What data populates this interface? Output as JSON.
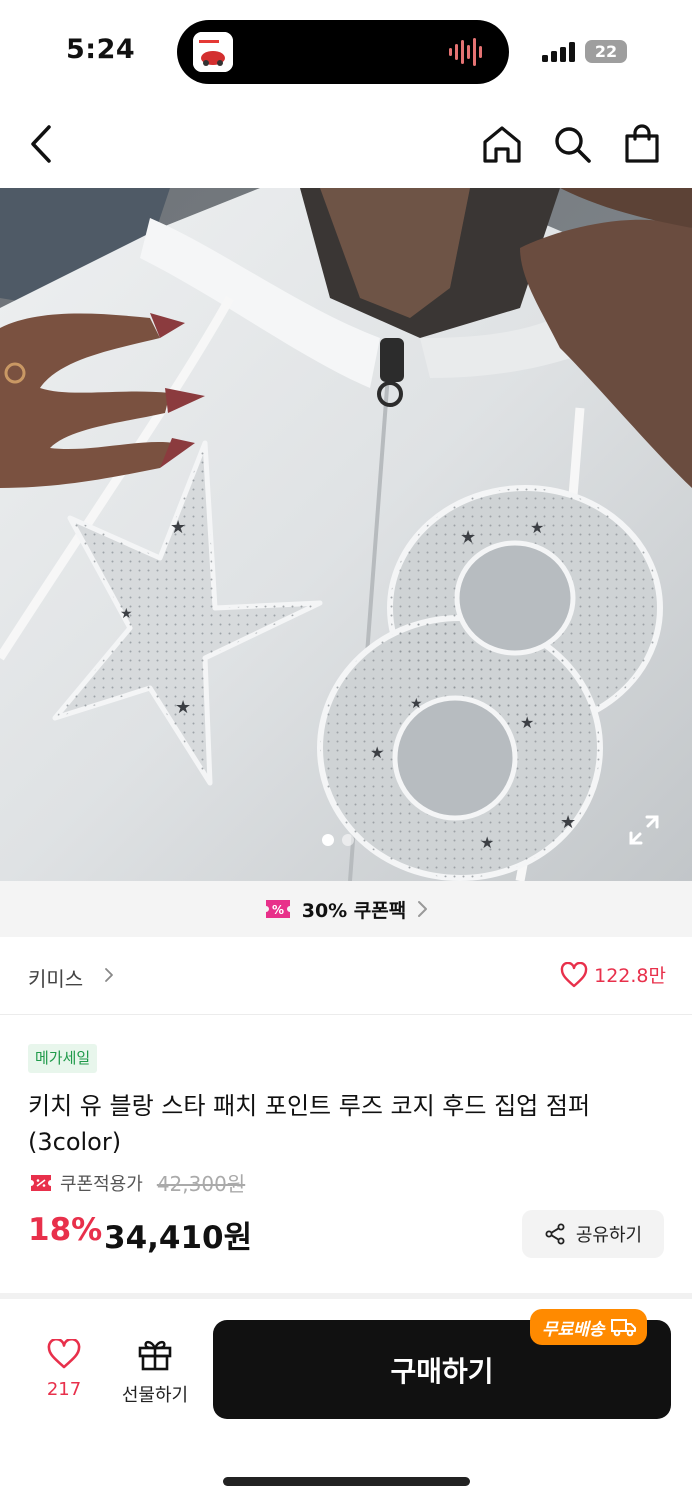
{
  "status_bar": {
    "time": "5:24",
    "battery": "22",
    "icons": [
      "app-icon",
      "audio-wave-icon",
      "signal-icon",
      "battery-icon"
    ]
  },
  "nav": {
    "icons": [
      "back-icon",
      "home-icon",
      "search-icon",
      "shopping-bag-icon"
    ]
  },
  "gallery": {
    "page_count": 2,
    "current_page": 1,
    "icons": [
      "expand-icon"
    ]
  },
  "coupon_strip": {
    "label": "30% 쿠폰팩",
    "icons": [
      "coupon-icon",
      "chevron-right-icon"
    ]
  },
  "brand": {
    "name": "키미스",
    "like_count": "122.8만",
    "icons": [
      "chevron-right-icon",
      "heart-outline-icon"
    ]
  },
  "product": {
    "badge": "메가세일",
    "title": "키치 유 블랑 스타 패치 포인트 루즈 코지 후드 집업 점퍼 (3color)",
    "coupon_price_label": "쿠폰적용가",
    "original_price": "42,300원",
    "discount_rate": "18%",
    "sale_price": "34,410원",
    "share_label": "공유하기"
  },
  "bottom_bar": {
    "wish_count": "217",
    "gift_label": "선물하기",
    "buy_label": "구매하기",
    "free_shipping": "무료배송"
  },
  "colors": {
    "accent": "#e8304b",
    "badge_green": "#1f9a4a",
    "badge_bg": "#e8f6ec",
    "buy_button": "#111111",
    "free_shipping": "#ff8a00",
    "coupon_pink": "#e8308a"
  }
}
